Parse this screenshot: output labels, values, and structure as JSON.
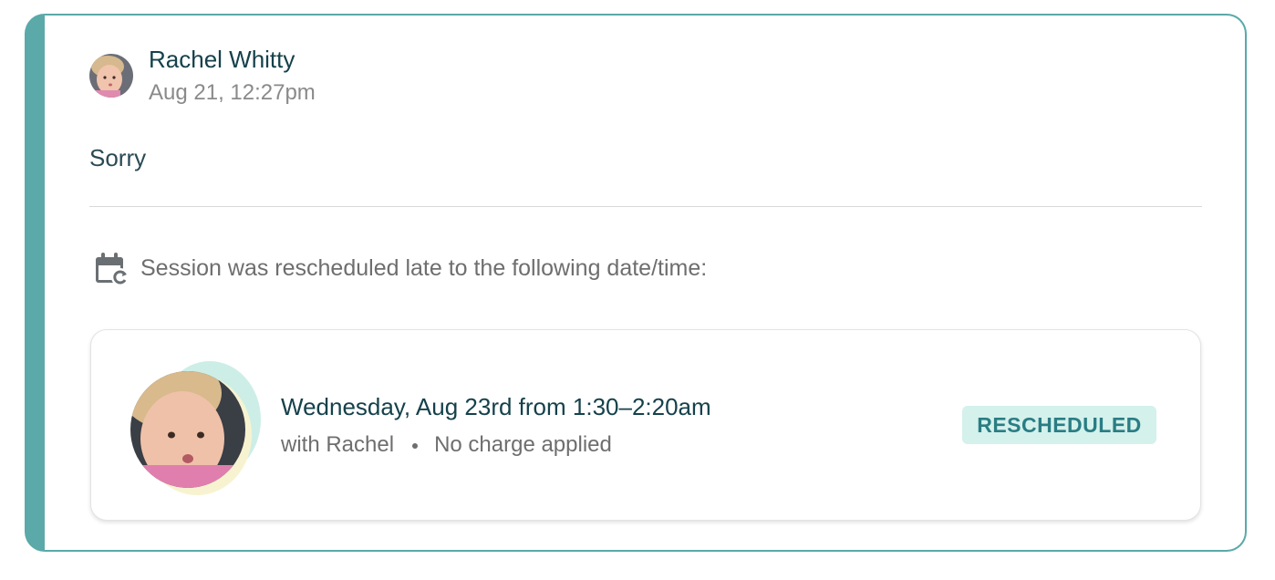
{
  "message": {
    "sender_name": "Rachel Whitty",
    "timestamp": "Aug 21, 12:27pm",
    "body": "Sorry",
    "avatar_icon": "user-avatar-photo"
  },
  "notice": {
    "icon": "calendar-reschedule-icon",
    "text": "Session was rescheduled late to the following date/time:"
  },
  "session": {
    "date_time": "Wednesday, Aug 23rd from 1:30–2:20am",
    "with": "with Rachel",
    "charge": "No charge applied",
    "status": "RESCHEDULED",
    "status_bg_color": "#d4f1ec",
    "status_text_color": "#2a7d84"
  },
  "colors": {
    "accent": "#5ba9a9",
    "title_text": "#15414b",
    "muted_text": "#8a8a8a"
  }
}
